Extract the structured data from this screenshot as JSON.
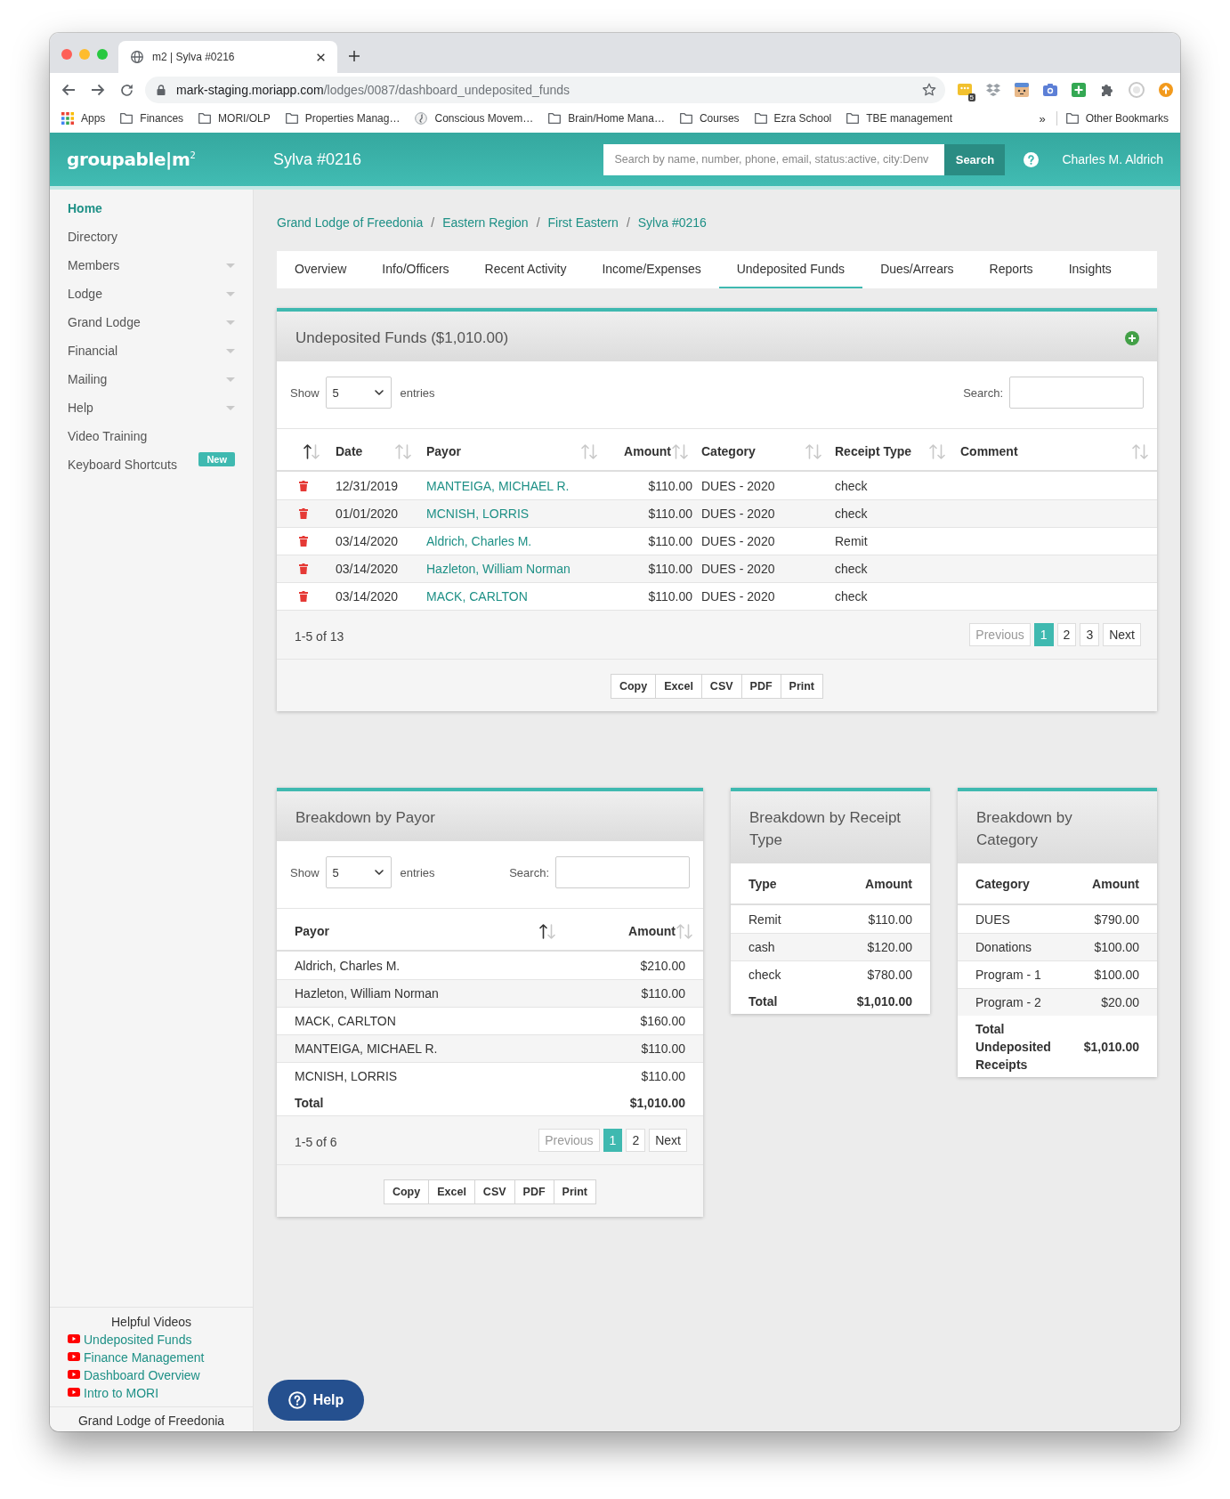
{
  "browser": {
    "tab_title": "m2 | Sylva #0216",
    "url_host": "mark-staging.moriapp.com",
    "url_path": "/lodges/0087/dashboard_undeposited_funds",
    "extension_badge": "5",
    "bookmarks": [
      {
        "label": "Apps",
        "kind": "apps"
      },
      {
        "label": "Finances",
        "kind": "folder"
      },
      {
        "label": "MORI/OLP",
        "kind": "folder"
      },
      {
        "label": "Properties Manag…",
        "kind": "folder"
      },
      {
        "label": "Conscious Movem…",
        "kind": "site"
      },
      {
        "label": "Brain/Home Mana…",
        "kind": "folder"
      },
      {
        "label": "Courses",
        "kind": "folder"
      },
      {
        "label": "Ezra School",
        "kind": "folder"
      },
      {
        "label": "TBE management",
        "kind": "folder"
      }
    ],
    "bookmarks_more": "»",
    "other_bookmarks": "Other Bookmarks"
  },
  "header": {
    "logo": "groupable|m$^{2}$",
    "lodge": "Sylva #0216",
    "search": {
      "placeholder": "Search by name, number, phone, email, status:active, city:Denv"
    },
    "search_button": "Search",
    "user": "Charles M. Aldrich"
  },
  "sidebar": {
    "items": [
      {
        "label": "Home",
        "selected": true,
        "expandable": false
      },
      {
        "label": "Directory",
        "selected": false,
        "expandable": false
      },
      {
        "label": "Members",
        "selected": false,
        "expandable": true
      },
      {
        "label": "Lodge",
        "selected": false,
        "expandable": true
      },
      {
        "label": "Grand Lodge",
        "selected": false,
        "expandable": true
      },
      {
        "label": "Financial",
        "selected": false,
        "expandable": true
      },
      {
        "label": "Mailing",
        "selected": false,
        "expandable": true
      },
      {
        "label": "Help",
        "selected": false,
        "expandable": true
      },
      {
        "label": "Video Training",
        "selected": false,
        "expandable": false
      },
      {
        "label": "Keyboard Shortcuts",
        "selected": false,
        "expandable": false,
        "badge": "New"
      }
    ],
    "videos_title": "Helpful Videos",
    "videos": [
      "Undeposited Funds",
      "Finance Management",
      "Dashboard Overview",
      "Intro to MORI"
    ],
    "footer": "Grand Lodge of Freedonia"
  },
  "breadcrumb": [
    {
      "label": "Grand Lodge of Freedonia",
      "kind": "link"
    },
    {
      "label": "/",
      "kind": "separator"
    },
    {
      "label": "Eastern Region",
      "kind": "link"
    },
    {
      "label": "/",
      "kind": "separator"
    },
    {
      "label": "First Eastern",
      "kind": "link"
    },
    {
      "label": "/",
      "kind": "separator"
    },
    {
      "label": "Sylva #0216",
      "kind": "link"
    }
  ],
  "tabs": [
    {
      "label": "Overview",
      "selected": false
    },
    {
      "label": "Info/Officers",
      "selected": false
    },
    {
      "label": "Recent Activity",
      "selected": false
    },
    {
      "label": "Income/Expenses",
      "selected": false
    },
    {
      "label": "Undeposited Funds",
      "selected": true
    },
    {
      "label": "Dues/Arrears",
      "selected": false
    },
    {
      "label": "Reports",
      "selected": false
    },
    {
      "label": "Insights",
      "selected": false
    }
  ],
  "funds_panel": {
    "title": "Undeposited Funds ($1,010.00)",
    "show_label": "Show",
    "page_size": "5",
    "entries_label": "entries",
    "search_label": "Search:",
    "columns": [
      {
        "sorted": true
      },
      {
        "label": "Date",
        "sorted": false
      },
      {
        "label": "Payor",
        "sorted": false
      },
      {
        "label": "Amount",
        "sorted": false
      },
      {
        "label": "Category",
        "sorted": false
      },
      {
        "label": "Receipt Type",
        "sorted": false
      },
      {
        "label": "Comment",
        "sorted": false
      }
    ],
    "rows": [
      {
        "date": "12/31/2019",
        "payor": "MANTEIGA, MICHAEL R.",
        "amount": "$110.00",
        "category": "DUES - 2020",
        "receipt_type": "check"
      },
      {
        "date": "01/01/2020",
        "payor": "MCNISH, LORRIS",
        "amount": "$110.00",
        "category": "DUES - 2020",
        "receipt_type": "check"
      },
      {
        "date": "03/14/2020",
        "payor": "Aldrich, Charles M.",
        "amount": "$110.00",
        "category": "DUES - 2020",
        "receipt_type": "Remit"
      },
      {
        "date": "03/14/2020",
        "payor": "Hazleton, William Norman",
        "amount": "$110.00",
        "category": "DUES - 2020",
        "receipt_type": "check"
      },
      {
        "date": "03/14/2020",
        "payor": "MACK, CARLTON",
        "amount": "$110.00",
        "category": "DUES - 2020",
        "receipt_type": "check"
      }
    ],
    "info": "1-5 of 13",
    "pagination": [
      {
        "label": "Previous",
        "selected": false,
        "disabled": true
      },
      {
        "label": "1",
        "selected": true,
        "disabled": false
      },
      {
        "label": "2",
        "selected": false,
        "disabled": false
      },
      {
        "label": "3",
        "selected": false,
        "disabled": false
      },
      {
        "label": "Next",
        "selected": false,
        "disabled": false
      }
    ],
    "export_buttons": [
      "Copy",
      "Excel",
      "CSV",
      "PDF",
      "Print"
    ]
  },
  "payor_panel": {
    "title": "Breakdown by Payor",
    "show_label": "Show",
    "page_size": "5",
    "entries_label": "entries",
    "search_label": "Search:",
    "columns": [
      {
        "label": "Payor",
        "sorted": true
      },
      {
        "label": "Amount",
        "sorted": false
      }
    ],
    "rows": [
      {
        "label": "Aldrich, Charles M.",
        "amount": "$210.00"
      },
      {
        "label": "Hazleton, William Norman",
        "amount": "$110.00"
      },
      {
        "label": "MACK, CARLTON",
        "amount": "$160.00"
      },
      {
        "label": "MANTEIGA, MICHAEL R.",
        "amount": "$110.00"
      },
      {
        "label": "MCNISH, LORRIS",
        "amount": "$110.00"
      }
    ],
    "total": {
      "label": "Total",
      "amount": "$1,010.00"
    },
    "info": "1-5 of 6",
    "pagination": [
      {
        "label": "Previous",
        "selected": false,
        "disabled": true
      },
      {
        "label": "1",
        "selected": true,
        "disabled": false
      },
      {
        "label": "2",
        "selected": false,
        "disabled": false
      },
      {
        "label": "Next",
        "selected": false,
        "disabled": false
      }
    ],
    "export_buttons": [
      "Copy",
      "Excel",
      "CSV",
      "PDF",
      "Print"
    ]
  },
  "receipt_panel": {
    "title": "Breakdown by Receipt Type",
    "columns": [
      "Type",
      "Amount"
    ],
    "rows": [
      {
        "label": "Remit",
        "amount": "$110.00"
      },
      {
        "label": "cash",
        "amount": "$120.00"
      },
      {
        "label": "check",
        "amount": "$780.00"
      }
    ],
    "total": {
      "label": "Total",
      "amount": "$1,010.00"
    }
  },
  "category_panel": {
    "title": "Breakdown by Category",
    "columns": [
      "Category",
      "Amount"
    ],
    "rows": [
      {
        "label": "DUES",
        "amount": "$790.00"
      },
      {
        "label": "Donations",
        "amount": "$100.00"
      },
      {
        "label": "Program - 1",
        "amount": "$100.00"
      },
      {
        "label": "Program - 2",
        "amount": "$20.00"
      }
    ],
    "total": {
      "label": "Total Undeposited Receipts",
      "amount": "$1,010.00"
    }
  },
  "help_button": "Help"
}
